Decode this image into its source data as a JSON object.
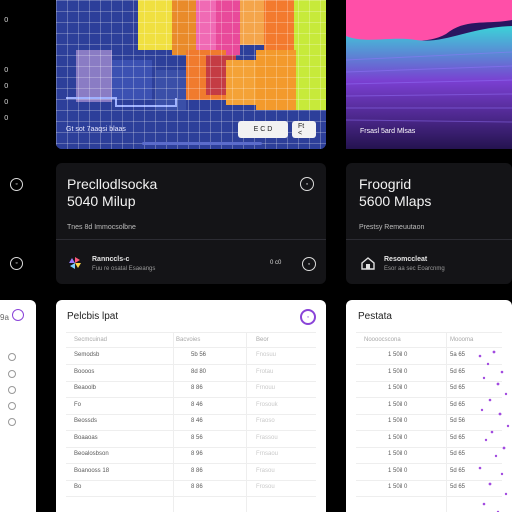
{
  "rail": {
    "items": [
      "0",
      "0",
      "0",
      "0"
    ]
  },
  "map": {
    "legend": "Gt sot 7aaqsi blaas",
    "buttons": [
      "E  C  D",
      "Ft  <"
    ]
  },
  "terrain": {
    "label": "Frsasl 5ard Mlsas"
  },
  "card1": {
    "title_line1": "Precllodlsocka",
    "title_line2": "5040 Milup",
    "subtitle": "Tnes 8d Immocsolbne",
    "footer_title": "Rannccls-c",
    "footer_sub": "Fuu re osatal Esaeangs",
    "badge": "0  c0"
  },
  "card2": {
    "title_line1": "Froogrid",
    "title_line2": "5600 Mlaps",
    "subtitle": "Prestsy Remeuutaon",
    "footer_title": "Resomccleat",
    "footer_sub": "Esor aa sec Eoarcnmg"
  },
  "table1": {
    "title": "Pelcbis lpat",
    "headers": [
      "Secmcuinad",
      "Bacvoies",
      "Beor"
    ],
    "rows": [
      [
        "Semodsb",
        "5b 56",
        "Fnosuu"
      ],
      [
        "Boooos",
        "8d 80",
        "Frotau"
      ],
      [
        "Beaoolb",
        "8 86",
        "Frnouu"
      ],
      [
        "Fo",
        "8 46",
        "Frosouk"
      ],
      [
        "Beossds",
        "8 46",
        "Fraoso"
      ],
      [
        "Boaaoas",
        "8 56",
        "Frassou"
      ],
      [
        "Beoalosbson",
        "8 96",
        "Frnsaou"
      ],
      [
        "Boanooss  18",
        "8 86",
        "Frasou"
      ],
      [
        "Bo",
        "8 86",
        "Frosou"
      ]
    ]
  },
  "table2": {
    "title": "Pestata",
    "headers": [
      "Noooocscona",
      "Moooma"
    ],
    "rows": [
      [
        "1 50il 0",
        "5a 65"
      ],
      [
        "1 50il 0",
        "5d 65"
      ],
      [
        "1 50il 0",
        "5d 65"
      ],
      [
        "1 50il 0",
        "5d 65"
      ],
      [
        "1 50il 0",
        "5d 56"
      ],
      [
        "1 50il 0",
        "5d 65"
      ],
      [
        "1 50il 0",
        "5d 65"
      ],
      [
        "1 50il 0",
        "5d 65"
      ],
      [
        "1 50il 0",
        "5d 65"
      ]
    ]
  },
  "left_partial": {
    "label": "9a"
  }
}
